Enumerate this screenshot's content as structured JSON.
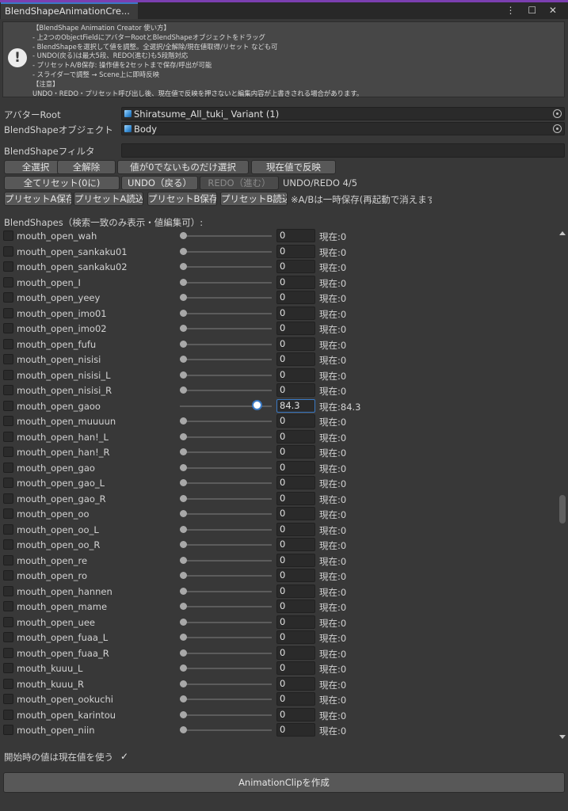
{
  "window": {
    "tab_title": "BlendShapeAnimationCre...",
    "ctrl_icons": "⋮ ☐ ✕"
  },
  "help": {
    "lines": [
      "【BlendShape Animation Creator 使い方】",
      "- 上2つのObjectFieldにアバターRootとBlendShapeオブジェクトをドラッグ",
      "- BlendShapeを選択して値を調整。全選択/全解除/現在値取得/リセット なども可",
      "- UNDO(戻る)は最大5段、REDO(進む)も5段階対応",
      "- プリセットA/B保存: 操作値を2セットまで保存/呼出が可能",
      "- スライダーで調整 → Scene上に即時反映",
      "【注意】",
      "UNDO・REDO・プリセット呼び出し後、現在値で反映を押さないと編集内容が上書きされる場合があります。"
    ]
  },
  "fields": {
    "avatar_root_label": "アバターRoot",
    "avatar_root_value": "Shiratsume_All_tuki_ Variant (1)",
    "blendshape_obj_label": "BlendShapeオブジェクト",
    "blendshape_obj_value": "Body",
    "filter_label": "BlendShapeフィルタ",
    "filter_value": ""
  },
  "toolbar": {
    "select_all": "全選択",
    "deselect_all": "全解除",
    "select_nonzero": "値が0でないものだけ選択",
    "apply_current": "現在値で反映",
    "reset_all": "全てリセット(0に)",
    "undo": "UNDO（戻る）",
    "redo": "REDO（進む）",
    "undo_status": "UNDO/REDO 4/5",
    "preset_a_save": "プリセットA保存",
    "preset_a_load": "プリセットA読込",
    "preset_b_save": "プリセットB保存",
    "preset_b_load": "プリセットB読込",
    "preset_note": "※A/Bは一時保存(再起動で消えます)"
  },
  "list": {
    "header": "BlendShapes（検索一致のみ表示・値編集可）:",
    "current_prefix": "現在:",
    "items": [
      {
        "name": "mouth_open_wah",
        "value": "0",
        "current": "0",
        "level": 0
      },
      {
        "name": "mouth_open_sankaku01",
        "value": "0",
        "current": "0",
        "level": 0
      },
      {
        "name": "mouth_open_sankaku02",
        "value": "0",
        "current": "0",
        "level": 0
      },
      {
        "name": "mouth_open_I",
        "value": "0",
        "current": "0",
        "level": 0
      },
      {
        "name": "mouth_open_yeey",
        "value": "0",
        "current": "0",
        "level": 0
      },
      {
        "name": "mouth_open_imo01",
        "value": "0",
        "current": "0",
        "level": 0
      },
      {
        "name": "mouth_open_imo02",
        "value": "0",
        "current": "0",
        "level": 0
      },
      {
        "name": "mouth_open_fufu",
        "value": "0",
        "current": "0",
        "level": 0
      },
      {
        "name": "mouth_open_nisisi",
        "value": "0",
        "current": "0",
        "level": 0
      },
      {
        "name": "mouth_open_nisisi_L",
        "value": "0",
        "current": "0",
        "level": 0
      },
      {
        "name": "mouth_open_nisisi_R",
        "value": "0",
        "current": "0",
        "level": 0
      },
      {
        "name": "mouth_open_gaoo",
        "value": "84.3",
        "current": "84.3",
        "level": 84.3,
        "active": true
      },
      {
        "name": "mouth_open_muuuun",
        "value": "0",
        "current": "0",
        "level": 0
      },
      {
        "name": "mouth_open_han!_L",
        "value": "0",
        "current": "0",
        "level": 0
      },
      {
        "name": "mouth_open_han!_R",
        "value": "0",
        "current": "0",
        "level": 0
      },
      {
        "name": "mouth_open_gao",
        "value": "0",
        "current": "0",
        "level": 0
      },
      {
        "name": "mouth_open_gao_L",
        "value": "0",
        "current": "0",
        "level": 0
      },
      {
        "name": "mouth_open_gao_R",
        "value": "0",
        "current": "0",
        "level": 0
      },
      {
        "name": "mouth_open_oo",
        "value": "0",
        "current": "0",
        "level": 0
      },
      {
        "name": "mouth_open_oo_L",
        "value": "0",
        "current": "0",
        "level": 0
      },
      {
        "name": "mouth_open_oo_R",
        "value": "0",
        "current": "0",
        "level": 0
      },
      {
        "name": "mouth_open_re",
        "value": "0",
        "current": "0",
        "level": 0
      },
      {
        "name": "mouth_open_ro",
        "value": "0",
        "current": "0",
        "level": 0
      },
      {
        "name": "mouth_open_hannen",
        "value": "0",
        "current": "0",
        "level": 0
      },
      {
        "name": "mouth_open_mame",
        "value": "0",
        "current": "0",
        "level": 0
      },
      {
        "name": "mouth_open_uee",
        "value": "0",
        "current": "0",
        "level": 0
      },
      {
        "name": "mouth_open_fuaa_L",
        "value": "0",
        "current": "0",
        "level": 0
      },
      {
        "name": "mouth_open_fuaa_R",
        "value": "0",
        "current": "0",
        "level": 0
      },
      {
        "name": "mouth_kuuu_L",
        "value": "0",
        "current": "0",
        "level": 0
      },
      {
        "name": "mouth_kuuu_R",
        "value": "0",
        "current": "0",
        "level": 0
      },
      {
        "name": "mouth_open_ookuchi",
        "value": "0",
        "current": "0",
        "level": 0
      },
      {
        "name": "mouth_open_karintou",
        "value": "0",
        "current": "0",
        "level": 0
      },
      {
        "name": "mouth_open_niin",
        "value": "0",
        "current": "0",
        "level": 0
      }
    ]
  },
  "footer": {
    "use_current_label": "開始時の値は現在値を使う",
    "use_current_checked": true,
    "create_button": "AnimationClipを作成"
  },
  "colors": {
    "accent": "#3a79c4",
    "window_edge": "#7b3fb0",
    "background": "#383838"
  }
}
